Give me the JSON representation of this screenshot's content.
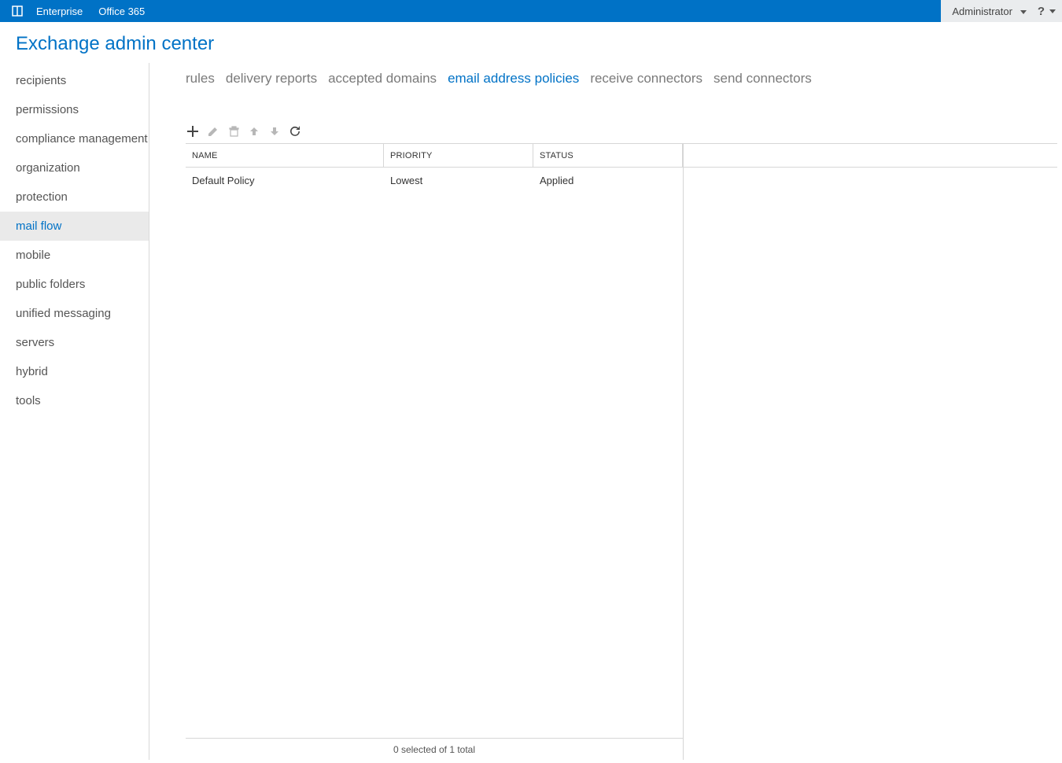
{
  "topbar": {
    "links": [
      "Enterprise",
      "Office 365"
    ],
    "user_label": "Administrator"
  },
  "page_title": "Exchange admin center",
  "sidebar": {
    "items": [
      "recipients",
      "permissions",
      "compliance management",
      "organization",
      "protection",
      "mail flow",
      "mobile",
      "public folders",
      "unified messaging",
      "servers",
      "hybrid",
      "tools"
    ],
    "selected_index": 5
  },
  "tabs": {
    "items": [
      "rules",
      "delivery reports",
      "accepted domains",
      "email address policies",
      "receive connectors",
      "send connectors"
    ],
    "selected_index": 3
  },
  "table": {
    "columns": [
      "NAME",
      "PRIORITY",
      "STATUS"
    ],
    "rows": [
      {
        "name": "Default Policy",
        "priority": "Lowest",
        "status": "Applied"
      }
    ],
    "footer": "0 selected of 1 total"
  }
}
